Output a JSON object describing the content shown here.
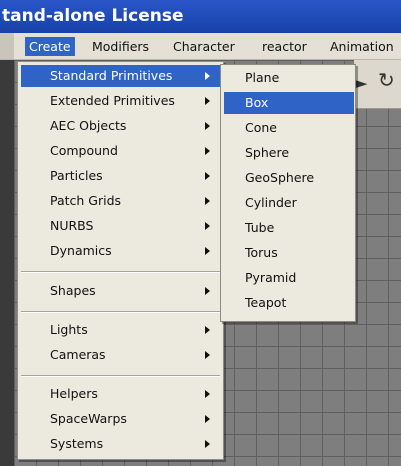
{
  "window": {
    "title": "tand-alone License"
  },
  "menubar": {
    "items": [
      {
        "label": "Create"
      },
      {
        "label": "Modifiers"
      },
      {
        "label": "Character"
      },
      {
        "label": "reactor"
      },
      {
        "label": "Animation"
      }
    ]
  },
  "create_menu": {
    "groups": [
      [
        {
          "label": "Standard Primitives"
        },
        {
          "label": "Extended Primitives"
        },
        {
          "label": "AEC Objects"
        },
        {
          "label": "Compound"
        },
        {
          "label": "Particles"
        },
        {
          "label": "Patch Grids"
        },
        {
          "label": "NURBS"
        },
        {
          "label": "Dynamics"
        }
      ],
      [
        {
          "label": "Shapes"
        }
      ],
      [
        {
          "label": "Lights"
        },
        {
          "label": "Cameras"
        }
      ],
      [
        {
          "label": "Helpers"
        },
        {
          "label": "SpaceWarps"
        },
        {
          "label": "Systems"
        }
      ]
    ],
    "highlighted": "Standard Primitives"
  },
  "standard_primitives_submenu": {
    "items": [
      {
        "label": "Plane"
      },
      {
        "label": "Box"
      },
      {
        "label": "Cone"
      },
      {
        "label": "Sphere"
      },
      {
        "label": "GeoSphere"
      },
      {
        "label": "Cylinder"
      },
      {
        "label": "Tube"
      },
      {
        "label": "Torus"
      },
      {
        "label": "Pyramid"
      },
      {
        "label": "Teapot"
      }
    ],
    "highlighted": "Box"
  },
  "colors": {
    "titlebar": "#1f4ab8",
    "highlight": "#2f63c6",
    "menu_bg": "#ece9de"
  }
}
